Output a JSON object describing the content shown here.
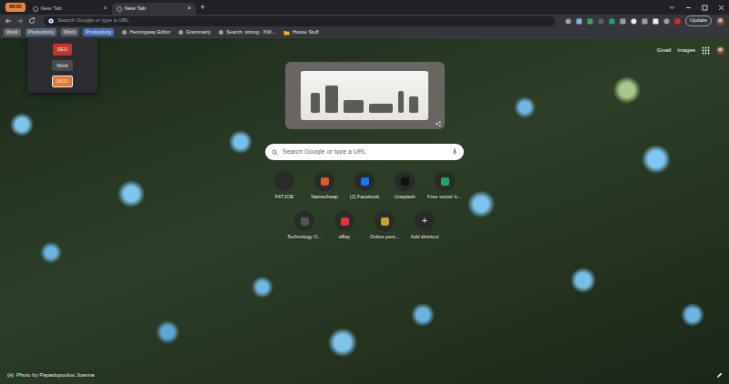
{
  "tab_group": {
    "label": "MUD",
    "color": "#f0873a"
  },
  "tabs": [
    {
      "title": "New Tab",
      "close": "×",
      "selected": false
    },
    {
      "title": "New Tab",
      "close": "×",
      "selected": true
    }
  ],
  "new_tab_button": "+",
  "toolbar": {
    "address_placeholder": "Search Google or type a URL",
    "update_button": "Update"
  },
  "bookmarks": [
    {
      "label": "Work",
      "kind": "group",
      "color": "#5f6368"
    },
    {
      "label": "Productivity",
      "kind": "group",
      "color": "#55657a"
    },
    {
      "label": "Work",
      "kind": "group",
      "color": "#5f6368"
    },
    {
      "label": "Productivity",
      "kind": "group",
      "color": "#3d6db3"
    },
    {
      "label": "Hemingway Editor",
      "kind": "link"
    },
    {
      "label": "Grammarly",
      "kind": "link"
    },
    {
      "label": "Search: strong - XW...",
      "kind": "link"
    },
    {
      "label": "House Stuff",
      "kind": "folder"
    }
  ],
  "group_menu": [
    {
      "label": "SEO",
      "color": "#c5352b",
      "selected": false
    },
    {
      "label": "Work",
      "color": "#4a4b4f",
      "selected": false
    },
    {
      "label": "MUD",
      "color": "#e07a32",
      "selected": true
    }
  ],
  "top_links": [
    "Gmail",
    "Images"
  ],
  "search": {
    "placeholder": "Search Google or type a URL"
  },
  "shortcuts": [
    {
      "title": "FATJOE",
      "kind": "site",
      "color": "#2b2b2b"
    },
    {
      "title": "Namecheap",
      "kind": "site",
      "color": "#de5a2a"
    },
    {
      "title": "(2) Facebook",
      "kind": "site",
      "color": "#1877f2"
    },
    {
      "title": "Unsplash",
      "kind": "site",
      "color": "#111111"
    },
    {
      "title": "Free vector ic...",
      "kind": "site",
      "color": "#1fa463"
    },
    {
      "title": "Technology O...",
      "kind": "site",
      "color": "#555555"
    },
    {
      "title": "eBay",
      "kind": "site",
      "color": "#e53238"
    },
    {
      "title": "Online pers...",
      "kind": "site",
      "color": "#c9a227"
    },
    {
      "title": "Add shortcut",
      "kind": "add",
      "icon": "+"
    }
  ],
  "photo_credit": "Photo by Papadopoulou Joanna"
}
